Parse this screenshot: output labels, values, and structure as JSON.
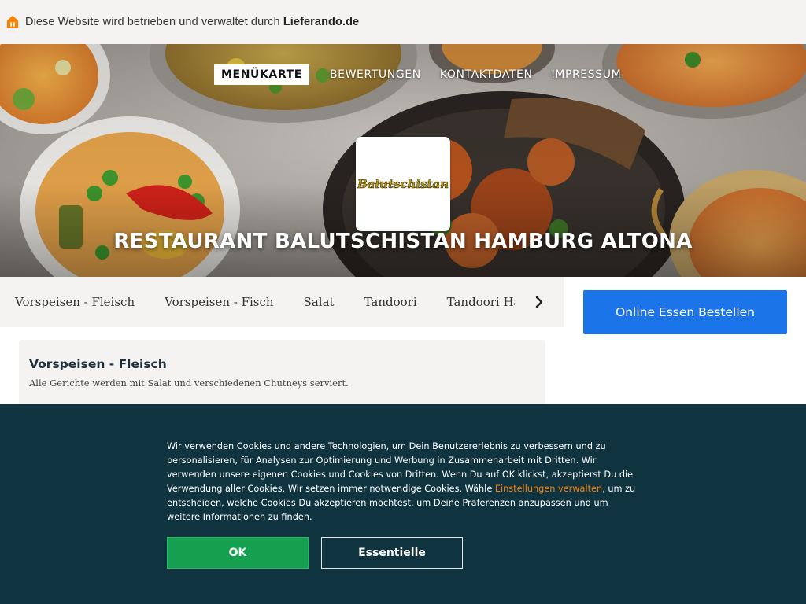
{
  "topbar": {
    "notice_prefix": "Diese Website wird betrieben und verwaltet durch ",
    "notice_brand": "Lieferando.de",
    "icon": "lieferando-house-icon",
    "icon_color": "#ff8000"
  },
  "nav": {
    "items": [
      {
        "label": "MENÜKARTE",
        "active": true
      },
      {
        "label": "BEWERTUNGEN",
        "active": false
      },
      {
        "label": "KONTAKTDATEN",
        "active": false
      },
      {
        "label": "IMPRESSUM",
        "active": false
      }
    ]
  },
  "hero": {
    "logo_text": "Balutschistan",
    "title": "RESTAURANT BALUTSCHISTAN HAMBURG ALTONA"
  },
  "categories": {
    "items": [
      "Vorspeisen - Fleisch",
      "Vorspeisen - Fisch",
      "Salat",
      "Tandoori",
      "Tandoori Hauptgerichte"
    ],
    "next_icon": "chevron-right-icon"
  },
  "order": {
    "button_label": "Online Essen Bestellen",
    "button_color": "#1b74e8"
  },
  "section": {
    "title": "Vorspeisen - Fleisch",
    "description": "Alle Gerichte werden mit Salat und verschiedenen Chutneys serviert."
  },
  "cookie": {
    "text_before_link": "Wir verwenden Cookies und andere Technologien, um Dein Benutzererlebnis zu verbessern und zu personalisieren, für Analysen zur Optimierung und Werbung in Zusammenarbeit mit Dritten. Wir verwenden unsere eigenen Cookies und Cookies von Dritten. Wenn Du auf OK klickst, akzeptierst Du die Verwendung aller Cookies. Wir setzen immer notwendige Cookies. Wähle ",
    "link_label": "Einstellungen verwalten",
    "text_after_link": ", um zu entscheiden, welche Cookies Du akzeptieren möchtest, um Deine Präferenzen anzupassen und um weitere Informationen zu finden.",
    "ok_label": "OK",
    "essential_label": "Essentielle",
    "background_color": "#0f3440",
    "ok_color": "#14a04e",
    "link_color": "#ff8000"
  }
}
